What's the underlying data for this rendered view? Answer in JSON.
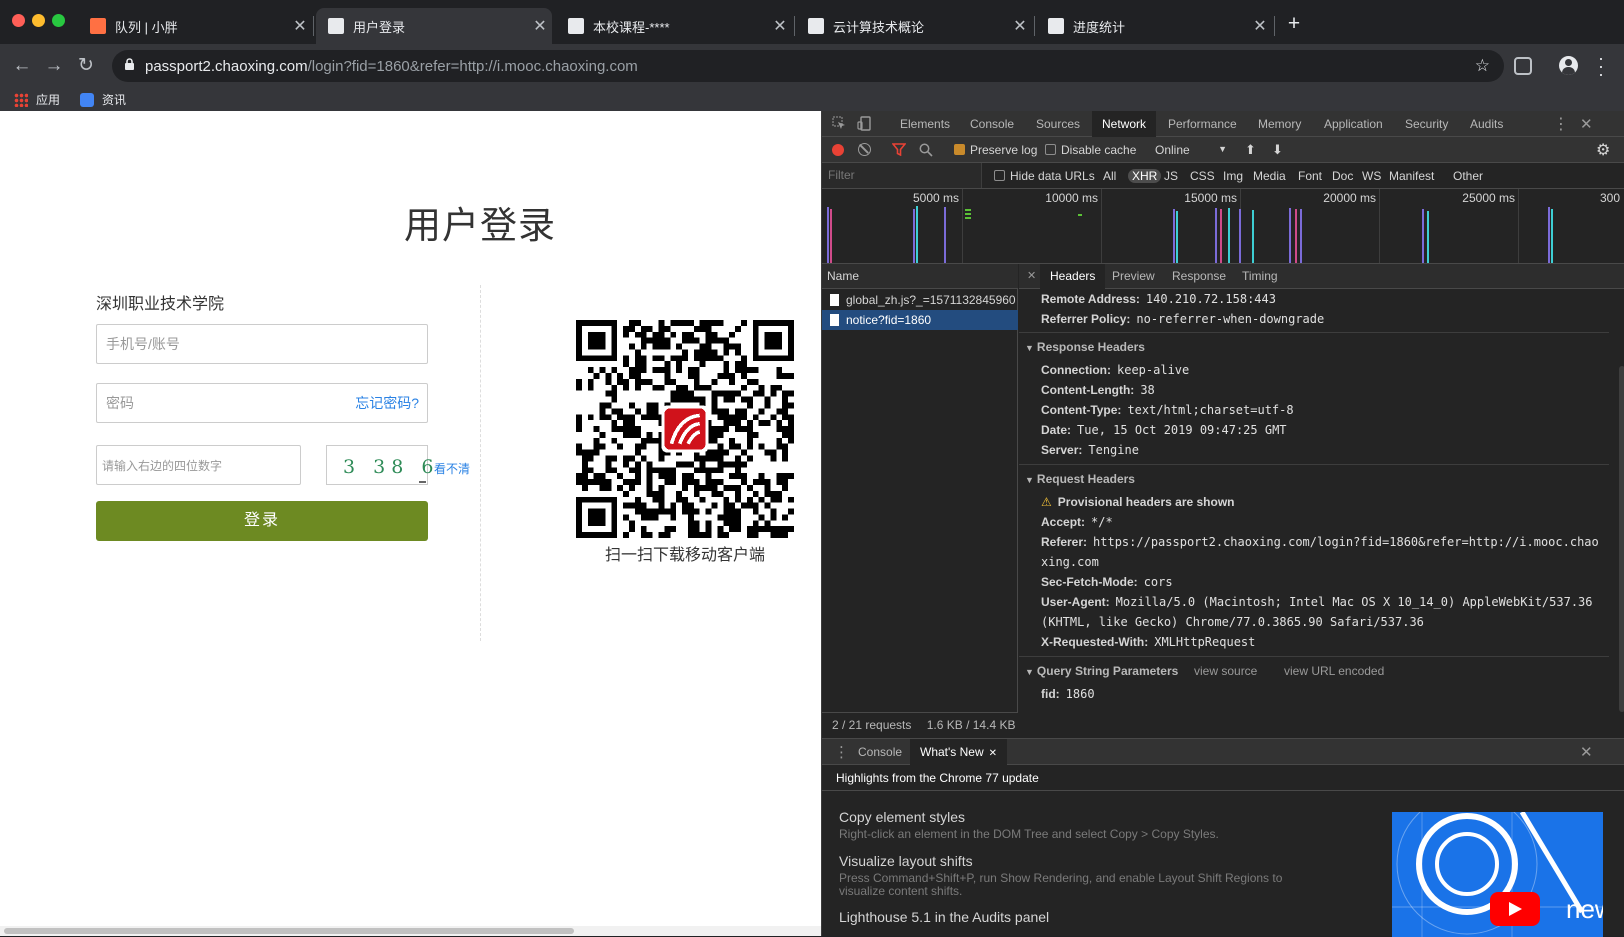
{
  "browser": {
    "tabs": [
      {
        "title": "队列 | 小胖",
        "active": false
      },
      {
        "title": "用户登录",
        "active": true
      },
      {
        "title": "本校课程-****",
        "active": false
      },
      {
        "title": "云计算技术概论",
        "active": false
      },
      {
        "title": "进度统计",
        "active": false
      }
    ],
    "new_tab_label": "+",
    "url_host": "passport2.chaoxing.com",
    "url_rest": "/login?fid=1860&refer=http://i.mooc.chaoxing.com",
    "bookmarks": [
      {
        "label": "应用",
        "icon": "apps-grid-icon"
      },
      {
        "label": "资讯",
        "icon": "news-icon"
      }
    ]
  },
  "login_page": {
    "title": "用户登录",
    "school_name": "深圳职业技术学院",
    "phone_placeholder": "手机号/账号",
    "password_placeholder": "密码",
    "forgot_password": "忘记密码?",
    "captcha_placeholder": "请输入右边的四位数字",
    "captcha_text": "3 38 6",
    "refresh_captcha": "看不清",
    "login_button": "登录",
    "qr_caption": "扫一扫下载移动客户端"
  },
  "devtools": {
    "panel_tabs": [
      "Elements",
      "Console",
      "Sources",
      "Network",
      "Performance",
      "Memory",
      "Application",
      "Security",
      "Audits"
    ],
    "active_panel": "Network",
    "preserve_log": "Preserve log",
    "disable_cache": "Disable cache",
    "throttle": "Online",
    "filter_placeholder": "Filter",
    "hide_data_urls": "Hide data URLs",
    "filter_types": [
      "All",
      "XHR",
      "JS",
      "CSS",
      "Img",
      "Media",
      "Font",
      "Doc",
      "WS",
      "Manifest",
      "Other"
    ],
    "active_filter": "XHR",
    "timeline_labels": [
      "5000 ms",
      "10000 ms",
      "15000 ms",
      "20000 ms",
      "25000 ms",
      "300"
    ],
    "name_header": "Name",
    "requests": [
      {
        "name": "global_zh.js?_=1571132845960",
        "selected": false
      },
      {
        "name": "notice?fid=1860",
        "selected": true
      }
    ],
    "status_requests": "2 / 21 requests",
    "status_size": "1.6 KB / 14.4 KB",
    "detail_tabs": [
      "Headers",
      "Preview",
      "Response",
      "Timing"
    ],
    "active_detail_tab": "Headers",
    "general": [
      {
        "k": "Remote Address:",
        "v": "140.210.72.158:443"
      },
      {
        "k": "Referrer Policy:",
        "v": "no-referrer-when-downgrade"
      }
    ],
    "response_headers_title": "Response Headers",
    "response_headers": [
      {
        "k": "Connection:",
        "v": "keep-alive"
      },
      {
        "k": "Content-Length:",
        "v": "38"
      },
      {
        "k": "Content-Type:",
        "v": "text/html;charset=utf-8"
      },
      {
        "k": "Date:",
        "v": "Tue, 15 Oct 2019 09:47:25 GMT"
      },
      {
        "k": "Server:",
        "v": "Tengine"
      }
    ],
    "request_headers_title": "Request Headers",
    "provisional_warning": "Provisional headers are shown",
    "request_headers": [
      {
        "k": "Accept:",
        "v": "*/*"
      },
      {
        "k": "Referer:",
        "v": "https://passport2.chaoxing.com/login?fid=1860&refer=http://i.mooc.chao",
        "v2": "xing.com"
      },
      {
        "k": "Sec-Fetch-Mode:",
        "v": "cors"
      },
      {
        "k": "User-Agent:",
        "v": "Mozilla/5.0 (Macintosh; Intel Mac OS X 10_14_0) AppleWebKit/537.36",
        "v2": "(KHTML, like Gecko) Chrome/77.0.3865.90 Safari/537.36"
      },
      {
        "k": "X-Requested-With:",
        "v": "XMLHttpRequest"
      }
    ],
    "query_title": "Query String Parameters",
    "view_source": "view source",
    "view_url_encoded": "view URL encoded",
    "query_params": [
      {
        "k": "fid:",
        "v": "1860"
      }
    ],
    "drawer_tabs": [
      "Console",
      "What's New"
    ],
    "active_drawer_tab": "What's New",
    "whats_new_title": "Highlights from the Chrome 77 update",
    "whats_new_items": [
      {
        "title": "Copy element styles",
        "desc": "Right-click an element in the DOM Tree and select Copy > Copy Styles."
      },
      {
        "title": "Visualize layout shifts",
        "desc": "Press Command+Shift+P, run Show Rendering, and enable Layout Shift Regions to visualize content shifts."
      },
      {
        "title": "Lighthouse 5.1 in the Audits panel",
        "desc": ""
      }
    ],
    "video_text": "new"
  },
  "colors": {
    "login_button": "#6d8a22",
    "link_blue": "#2a82e4",
    "devtools_selected": "#234c7f",
    "record_red": "#e94235"
  }
}
